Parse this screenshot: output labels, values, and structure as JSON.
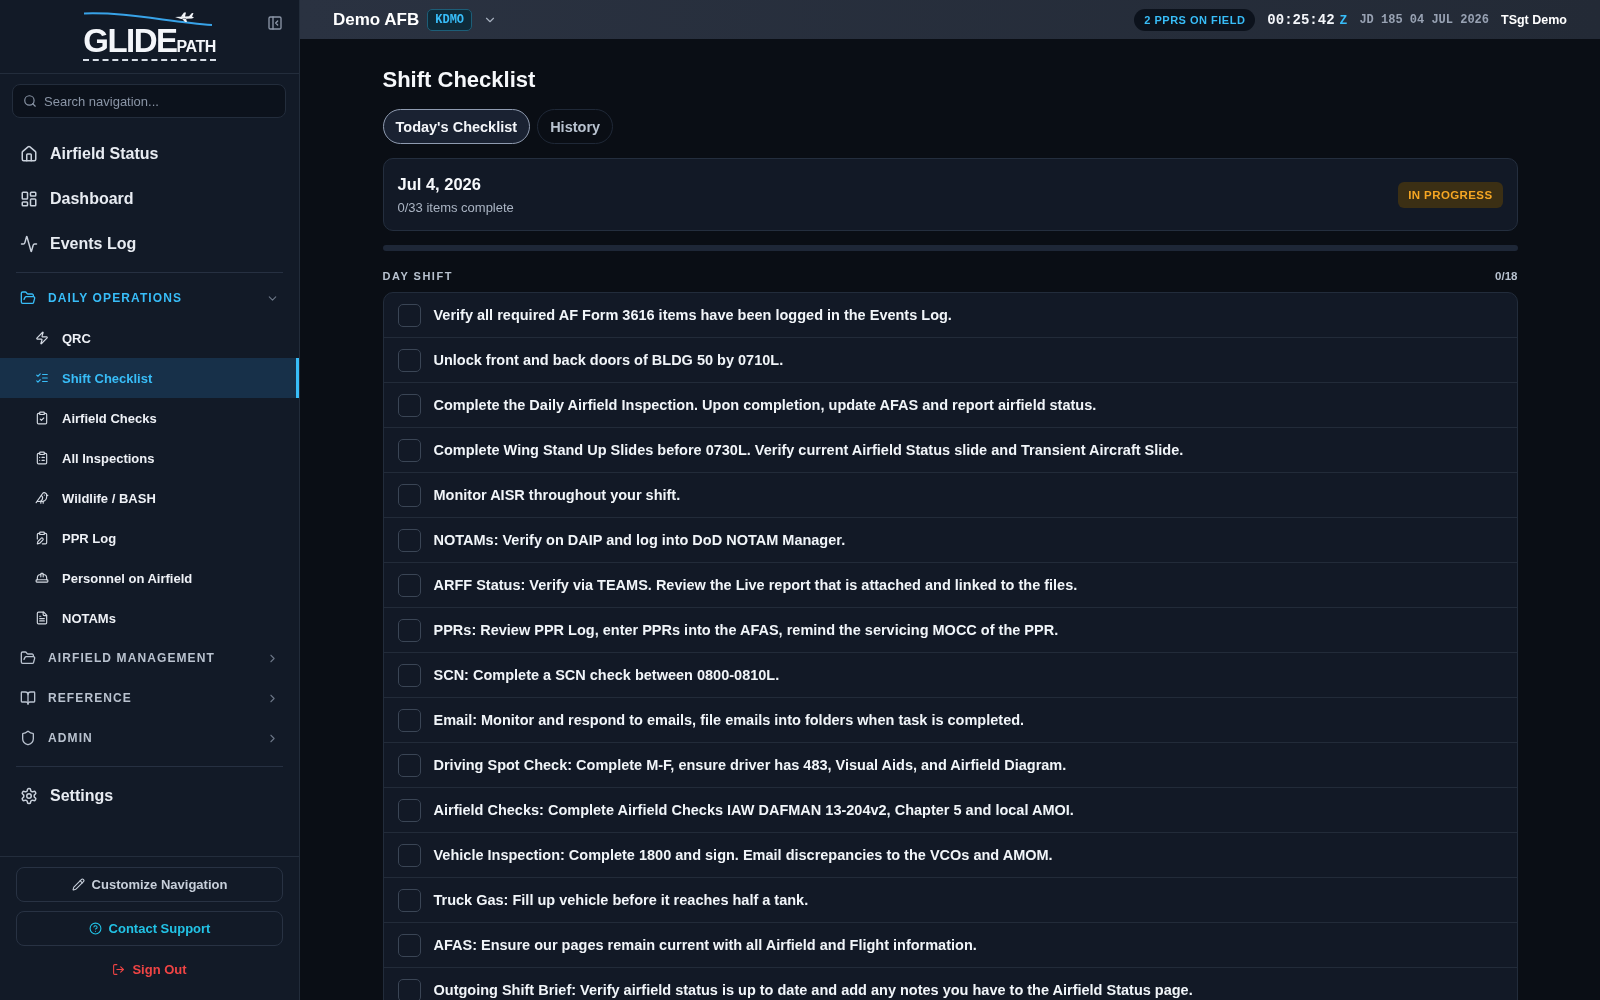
{
  "sidebar": {
    "logo": {
      "main": "GLIDE",
      "suffix": "PATH"
    },
    "search": {
      "placeholder": "Search navigation..."
    },
    "nav_items": [
      {
        "label": "Airfield Status",
        "selected": false
      },
      {
        "label": "Dashboard",
        "selected": false
      },
      {
        "label": "Events Log",
        "selected": false
      }
    ],
    "groups": [
      {
        "label": "DAILY OPERATIONS",
        "expanded": true,
        "items": [
          {
            "label": "QRC",
            "selected": false
          },
          {
            "label": "Shift Checklist",
            "selected": true
          },
          {
            "label": "Airfield Checks",
            "selected": false
          },
          {
            "label": "All Inspections",
            "selected": false
          },
          {
            "label": "Wildlife / BASH",
            "selected": false
          },
          {
            "label": "PPR Log",
            "selected": false
          },
          {
            "label": "Personnel on Airfield",
            "selected": false
          },
          {
            "label": "NOTAMs",
            "selected": false
          }
        ]
      },
      {
        "label": "AIRFIELD MANAGEMENT",
        "expanded": false
      },
      {
        "label": "REFERENCE",
        "expanded": false
      },
      {
        "label": "ADMIN",
        "expanded": false
      }
    ],
    "settings": {
      "label": "Settings",
      "selected": false
    },
    "customize_button": "Customize Navigation",
    "support_button": "Contact Support",
    "sign_out": "Sign Out"
  },
  "top_bar": {
    "base_name": "Demo AFB",
    "base_code": "KDMO",
    "ppr_badge": "2 PPRS ON FIELD",
    "clock": "00:25:42",
    "zone": "Z",
    "date": "JD 185 04 JUL 2026",
    "user": "TSgt Demo"
  },
  "page": {
    "title": "Shift Checklist",
    "tabs": [
      {
        "label": "Today's Checklist",
        "selected": true
      },
      {
        "label": "History",
        "selected": false
      }
    ],
    "summary": {
      "date": "Jul 4, 2026",
      "progress_text": "0/33 items complete",
      "status": "IN PROGRESS"
    },
    "progress_bar": {
      "level": 0
    },
    "sections": [
      {
        "title": "DAY SHIFT",
        "count": "0/18",
        "items": [
          {
            "text": "Verify all required AF Form 3616 items have been logged in the Events Log.",
            "checked": false
          },
          {
            "text": "Unlock front and back doors of BLDG 50 by 0710L.",
            "checked": false
          },
          {
            "text": "Complete the Daily Airfield Inspection. Upon completion, update AFAS and report airfield status.",
            "checked": false
          },
          {
            "text": "Complete Wing Stand Up Slides before 0730L. Verify current Airfield Status slide and Transient Aircraft Slide.",
            "checked": false
          },
          {
            "text": "Monitor AISR throughout your shift.",
            "checked": false
          },
          {
            "text": "NOTAMs: Verify on DAIP and log into DoD NOTAM Manager.",
            "checked": false
          },
          {
            "text": "ARFF Status: Verify via TEAMS. Review the Live report that is attached and linked to the files.",
            "checked": false
          },
          {
            "text": "PPRs: Review PPR Log, enter PPRs into the AFAS, remind the servicing MOCC of the PPR.",
            "checked": false
          },
          {
            "text": "SCN: Complete a SCN check between 0800-0810L.",
            "checked": false
          },
          {
            "text": "Email: Monitor and respond to emails, file emails into folders when task is completed.",
            "checked": false
          },
          {
            "text": "Driving Spot Check: Complete M-F, ensure driver has 483, Visual Aids, and Airfield Diagram.",
            "checked": false
          },
          {
            "text": "Airfield Checks: Complete Airfield Checks IAW DAFMAN 13-204v2, Chapter 5 and local AMOI.",
            "checked": false
          },
          {
            "text": "Vehicle Inspection: Complete 1800 and sign. Email discrepancies to the VCOs and AMOM.",
            "checked": false
          },
          {
            "text": "Truck Gas: Fill up vehicle before it reaches half a tank.",
            "checked": false
          },
          {
            "text": "AFAS: Ensure our pages remain current with all Airfield and Flight information.",
            "checked": false
          },
          {
            "text": "Outgoing Shift Brief: Verify airfield status is up to date and add any notes you have to the Airfield Status page.",
            "checked": false
          }
        ]
      }
    ]
  }
}
